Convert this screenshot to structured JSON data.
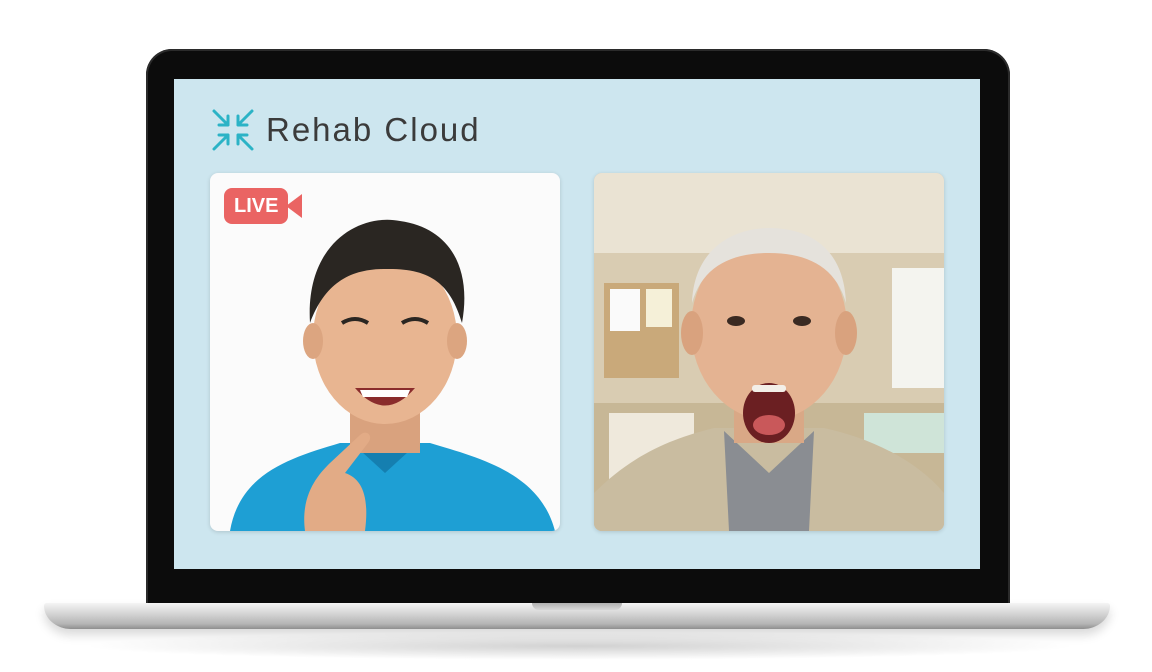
{
  "app": {
    "brand_name": "Rehab Cloud",
    "logo_icon": "arrows-inward-icon",
    "accent_color": "#2bb3c6",
    "background_color": "#cde6ef"
  },
  "video_call": {
    "host_tile": {
      "live_label": "LIVE",
      "live_color": "#ea6463",
      "camera_icon": "video-camera-icon"
    },
    "participant_tile": {}
  }
}
